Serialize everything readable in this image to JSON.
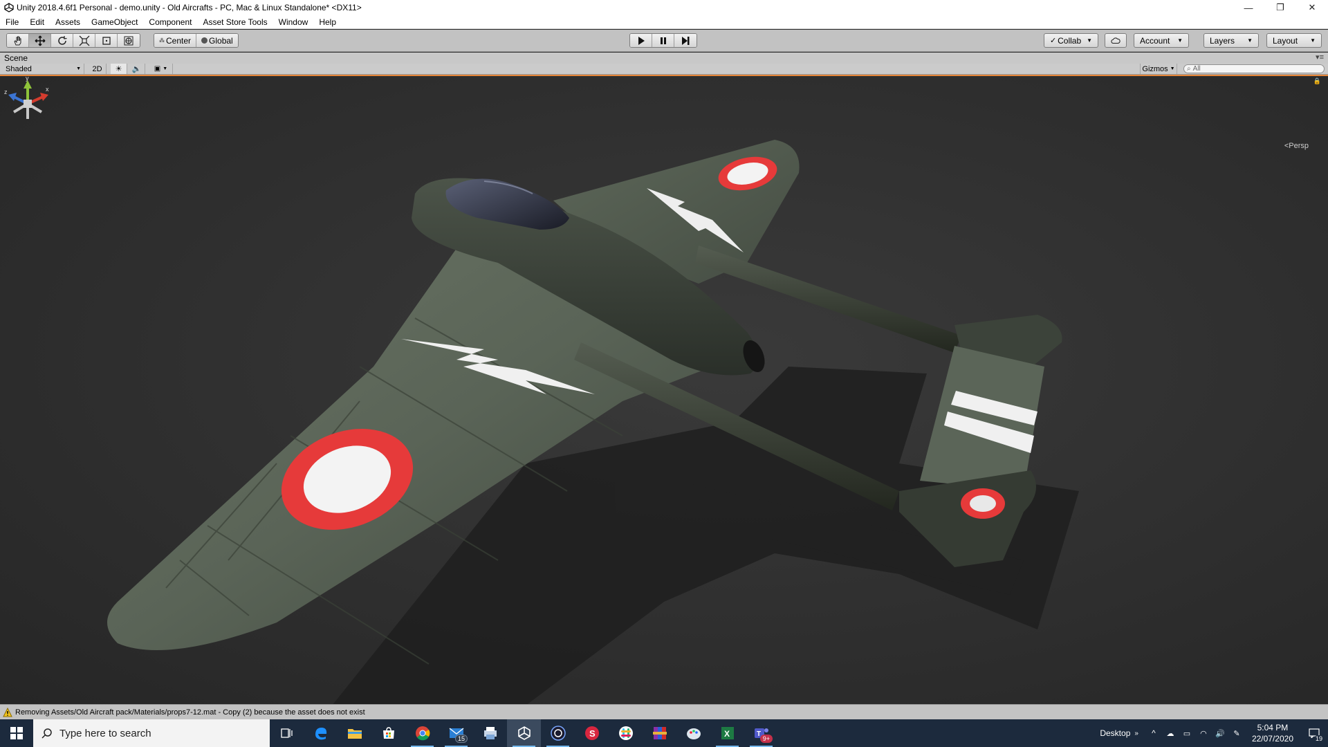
{
  "window": {
    "title": "Unity 2018.4.6f1 Personal - demo.unity - Old Aircrafts - PC, Mac & Linux Standalone* <DX11>",
    "minimize_glyph": "—",
    "restore_glyph": "❐",
    "close_glyph": "✕"
  },
  "menu": [
    "File",
    "Edit",
    "Assets",
    "GameObject",
    "Component",
    "Asset Store Tools",
    "Window",
    "Help"
  ],
  "toolbar": {
    "pivot": "Center",
    "handle_rotation": "Global",
    "collab": "Collab",
    "account": "Account",
    "layers": "Layers",
    "layout": "Layout"
  },
  "scene": {
    "tab_label": "Scene",
    "shading_mode": "Shaded",
    "mode_2d": "2D",
    "gizmos": "Gizmos",
    "search_placeholder": "All",
    "persp_label": "Persp",
    "gizmo_axes": {
      "y": "y",
      "x": "x",
      "z": "z"
    }
  },
  "status": {
    "message": "Removing Assets/Old Aircraft pack/Materials/props7-12.mat - Copy (2) because the asset does not exist"
  },
  "taskbar": {
    "search_placeholder": "Type here to search",
    "apps": [
      {
        "name": "task-view-icon"
      },
      {
        "name": "edge-icon"
      },
      {
        "name": "file-explorer-icon"
      },
      {
        "name": "store-icon"
      },
      {
        "name": "chrome-icon"
      },
      {
        "name": "mail-icon",
        "badge": "15"
      },
      {
        "name": "printer-app-icon"
      },
      {
        "name": "unity-app-icon"
      },
      {
        "name": "cinema4d-icon"
      },
      {
        "name": "substance-icon"
      },
      {
        "name": "slack-icon"
      },
      {
        "name": "winrar-icon"
      },
      {
        "name": "paint-icon"
      },
      {
        "name": "excel-icon"
      },
      {
        "name": "teams-icon",
        "badge": "9+"
      }
    ],
    "desktop_label": "Desktop",
    "time": "5:04 PM",
    "date": "22/07/2020",
    "notification_count": "19"
  },
  "colors": {
    "accent_orange": "#e8873a",
    "taskbar": "#1c2a3d",
    "roundel_red": "#e63a3a"
  }
}
